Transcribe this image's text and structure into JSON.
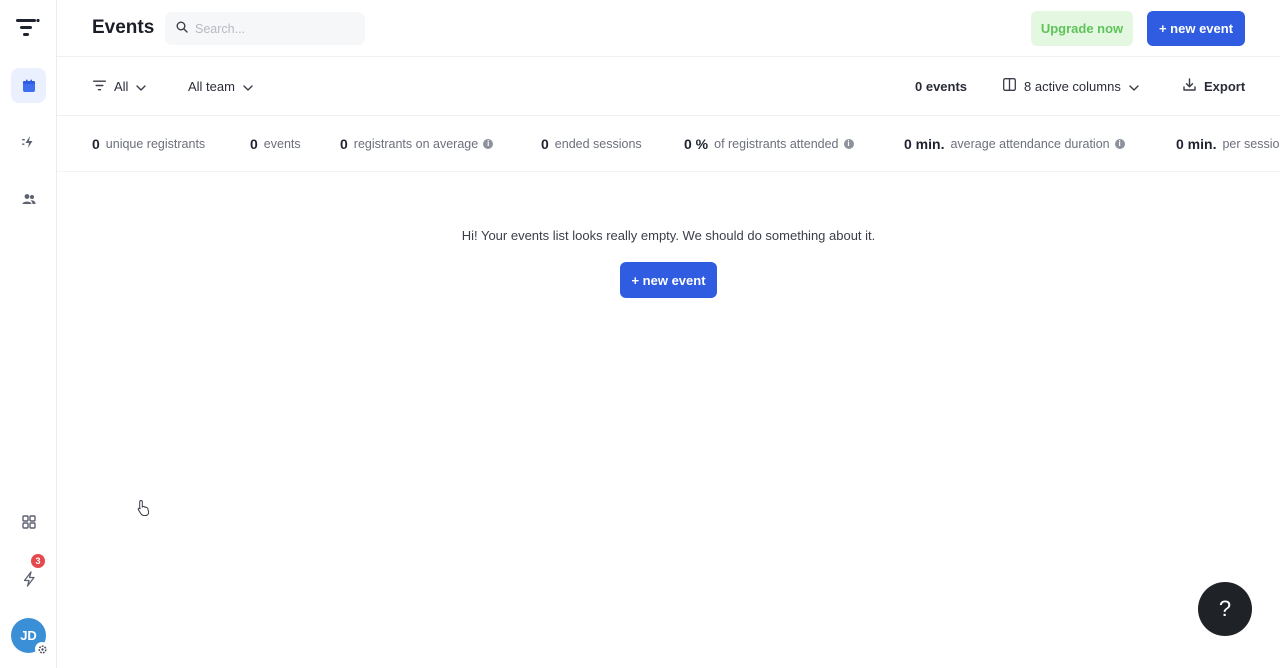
{
  "header": {
    "title": "Events",
    "search_placeholder": "Search...",
    "upgrade_label": "Upgrade now",
    "new_event_label": "+ new event"
  },
  "sidebar": {
    "items": [
      {
        "icon": "calendar-icon",
        "active": true
      },
      {
        "icon": "integrations-icon",
        "active": false
      },
      {
        "icon": "team-icon",
        "active": false
      }
    ],
    "bottom": [
      {
        "icon": "apps-grid-icon"
      },
      {
        "icon": "notifications-bolt-icon",
        "badge": "3"
      }
    ],
    "avatar_initials": "JD"
  },
  "toolbar": {
    "filter_label": "All",
    "team_label": "All team",
    "events_count": "0 events",
    "columns_label": "8 active columns",
    "export_label": "Export"
  },
  "stats": [
    {
      "value": "0",
      "label": "unique registrants",
      "info": false
    },
    {
      "value": "0",
      "label": "events",
      "info": false
    },
    {
      "value": "0",
      "label": "registrants on average",
      "info": true
    },
    {
      "value": "0",
      "label": "ended sessions",
      "info": false
    },
    {
      "value": "0 %",
      "label": "of registrants attended",
      "info": true
    },
    {
      "value": "0 min.",
      "label": "average attendance duration",
      "info": true
    },
    {
      "value": "0 min.",
      "label": "per session",
      "info": false
    }
  ],
  "empty_state": {
    "message": "Hi! Your events list looks really empty. We should do something about it.",
    "button_label": "+ new event"
  },
  "help_label": "?",
  "colors": {
    "primary": "#2f5ce0",
    "upgrade_bg": "#e4f8e1",
    "upgrade_text": "#5fc35a",
    "badge": "#e5484d",
    "avatar": "#3b8fd6"
  }
}
